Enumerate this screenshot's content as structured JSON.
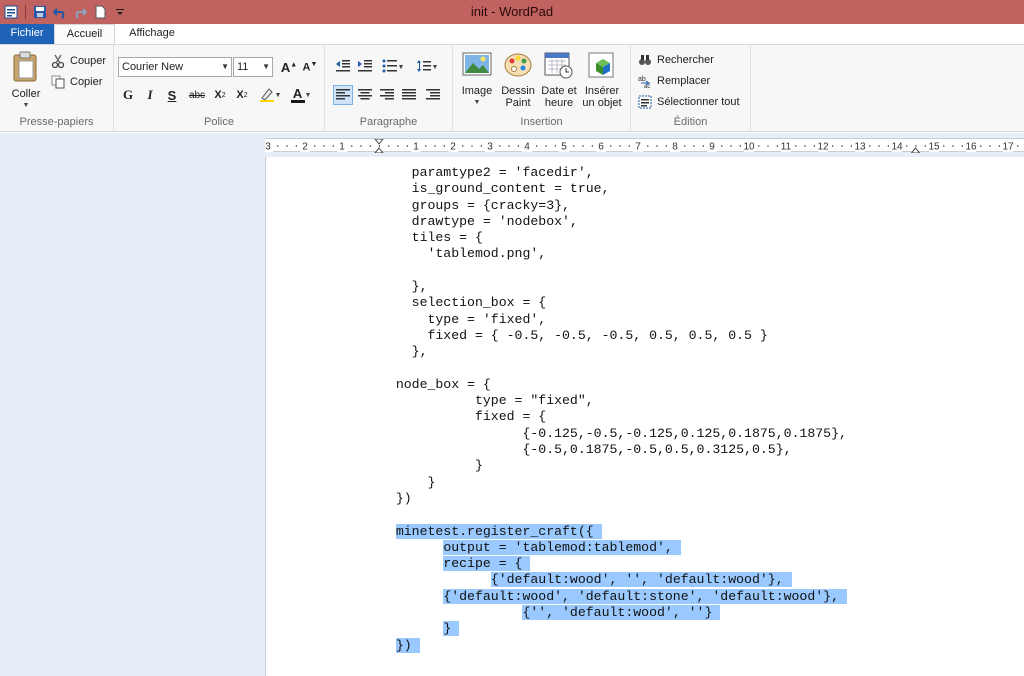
{
  "window": {
    "title": "init - WordPad",
    "titlebar_color": "#c0625f"
  },
  "quick_access": {
    "icons": [
      "wordpad-app-icon",
      "save-icon",
      "undo-icon",
      "redo-icon",
      "new-document-icon",
      "customize-dropdown-icon"
    ]
  },
  "tabs": {
    "file": "Fichier",
    "home": "Accueil",
    "view": "Affichage"
  },
  "clipboard": {
    "paste": "Coller",
    "cut": "Couper",
    "copy": "Copier",
    "label": "Presse-papiers"
  },
  "font": {
    "family": "Courier New",
    "size": "11",
    "label": "Police",
    "bold": "G",
    "italic": "I",
    "underline": "S",
    "strike": "abc",
    "subscript": "X",
    "superscript": "X",
    "color_letter": "A"
  },
  "paragraph": {
    "label": "Paragraphe"
  },
  "insert": {
    "image": "Image",
    "paint_line1": "Dessin",
    "paint_line2": "Paint",
    "datetime_line1": "Date et",
    "datetime_line2": "heure",
    "object_line1": "Insérer",
    "object_line2": "un objet",
    "label": "Insertion"
  },
  "editing": {
    "find": "Rechercher",
    "replace": "Remplacer",
    "select_all": "Sélectionner tout",
    "label": "Édition"
  },
  "ruler": {
    "labels": [
      "3",
      "2",
      "1",
      "1",
      "2",
      "3",
      "4",
      "5",
      "6",
      "7",
      "8",
      "9",
      "10",
      "11",
      "12",
      "13",
      "14",
      "15",
      "16",
      "17"
    ]
  },
  "document": {
    "lines": [
      {
        "text": "    paramtype2 = 'facedir',",
        "selected": false
      },
      {
        "text": "    is_ground_content = true,",
        "selected": false
      },
      {
        "text": "    groups = {cracky=3},",
        "selected": false
      },
      {
        "text": "    drawtype = 'nodebox',",
        "selected": false
      },
      {
        "text": "    tiles = {",
        "selected": false
      },
      {
        "text": "      'tablemod.png',",
        "selected": false
      },
      {
        "text": "",
        "selected": false
      },
      {
        "text": "    },",
        "selected": false
      },
      {
        "text": "    selection_box = {",
        "selected": false
      },
      {
        "text": "      type = 'fixed',",
        "selected": false
      },
      {
        "text": "      fixed = { -0.5, -0.5, -0.5, 0.5, 0.5, 0.5 }",
        "selected": false
      },
      {
        "text": "    },",
        "selected": false
      },
      {
        "text": "",
        "selected": false
      },
      {
        "text": "  node_box = {",
        "selected": false
      },
      {
        "text": "            type = \"fixed\",",
        "selected": false
      },
      {
        "text": "            fixed = {",
        "selected": false
      },
      {
        "text": "                  {-0.125,-0.5,-0.125,0.125,0.1875,0.1875},",
        "selected": false
      },
      {
        "text": "                  {-0.5,0.1875,-0.5,0.5,0.3125,0.5},",
        "selected": false
      },
      {
        "text": "            }",
        "selected": false
      },
      {
        "text": "      }",
        "selected": false
      },
      {
        "text": "  })",
        "selected": false
      },
      {
        "text": "",
        "selected": false
      },
      {
        "text": "  minetest.register_craft({",
        "selected": true
      },
      {
        "text": "        output = 'tablemod:tablemod',",
        "selected": true
      },
      {
        "text": "        recipe = {",
        "selected": true
      },
      {
        "text": "              {'default:wood', '', 'default:wood'},",
        "selected": true
      },
      {
        "text": "        {'default:wood', 'default:stone', 'default:wood'},",
        "selected": true
      },
      {
        "text": "                  {'', 'default:wood', ''}",
        "selected": true
      },
      {
        "text": "        }",
        "selected": true
      },
      {
        "text": "  })",
        "selected": true
      }
    ],
    "selection_color": "#99c9ff"
  }
}
